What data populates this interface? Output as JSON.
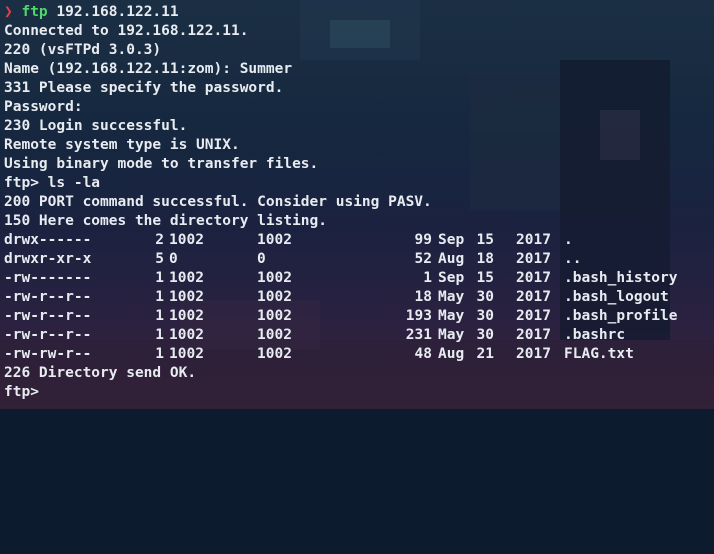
{
  "prompt": {
    "arrow": "❯",
    "command": "ftp",
    "argument": "192.168.122.11"
  },
  "output_before": [
    "Connected to 192.168.122.11.",
    "220 (vsFTPd 3.0.3)",
    "Name (192.168.122.11:zom): Summer",
    "331 Please specify the password.",
    "Password:",
    "230 Login successful.",
    "Remote system type is UNIX.",
    "Using binary mode to transfer files.",
    "ftp> ls -la",
    "200 PORT command successful. Consider using PASV.",
    "150 Here comes the directory listing."
  ],
  "listing": [
    {
      "perm": "drwx------",
      "links": "2",
      "owner": "1002",
      "group": "1002",
      "size": "99",
      "month": "Sep",
      "day": "15",
      "year": "2017",
      "name": "."
    },
    {
      "perm": "drwxr-xr-x",
      "links": "5",
      "owner": "0",
      "group": "0",
      "size": "52",
      "month": "Aug",
      "day": "18",
      "year": "2017",
      "name": ".."
    },
    {
      "perm": "-rw-------",
      "links": "1",
      "owner": "1002",
      "group": "1002",
      "size": "1",
      "month": "Sep",
      "day": "15",
      "year": "2017",
      "name": ".bash_history"
    },
    {
      "perm": "-rw-r--r--",
      "links": "1",
      "owner": "1002",
      "group": "1002",
      "size": "18",
      "month": "May",
      "day": "30",
      "year": "2017",
      "name": ".bash_logout"
    },
    {
      "perm": "-rw-r--r--",
      "links": "1",
      "owner": "1002",
      "group": "1002",
      "size": "193",
      "month": "May",
      "day": "30",
      "year": "2017",
      "name": ".bash_profile"
    },
    {
      "perm": "-rw-r--r--",
      "links": "1",
      "owner": "1002",
      "group": "1002",
      "size": "231",
      "month": "May",
      "day": "30",
      "year": "2017",
      "name": ".bashrc"
    },
    {
      "perm": "-rw-rw-r--",
      "links": "1",
      "owner": "1002",
      "group": "1002",
      "size": "48",
      "month": "Aug",
      "day": "21",
      "year": "2017",
      "name": "FLAG.txt"
    }
  ],
  "output_after": [
    "226 Directory send OK.",
    "ftp>"
  ],
  "colors": {
    "prompt_arrow": "#e0404a",
    "command": "#4fd96a",
    "text": "#e8ecf1",
    "background": "#0d1b2e"
  }
}
